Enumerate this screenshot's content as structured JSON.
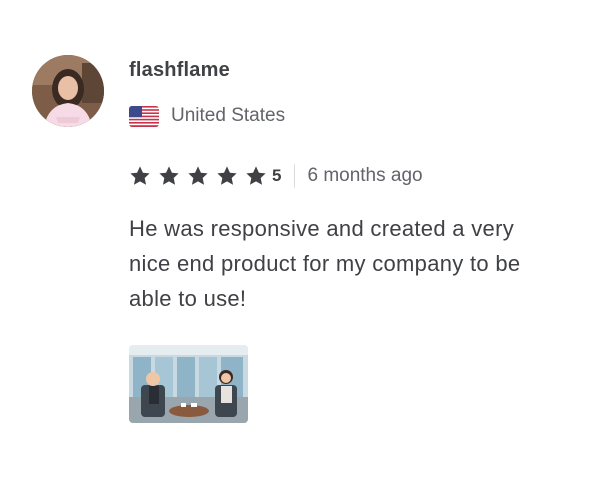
{
  "review": {
    "username": "flashflame",
    "country": "United States",
    "flag_icon": "us-flag-icon",
    "rating": {
      "stars": 5,
      "score_label": "5",
      "star_color": "#404145"
    },
    "time_ago": "6 months ago",
    "text": "He was responsive and created a very nice end product for my company to be able to use!",
    "attachment": {
      "icon": "video-thumbnail-image"
    }
  }
}
